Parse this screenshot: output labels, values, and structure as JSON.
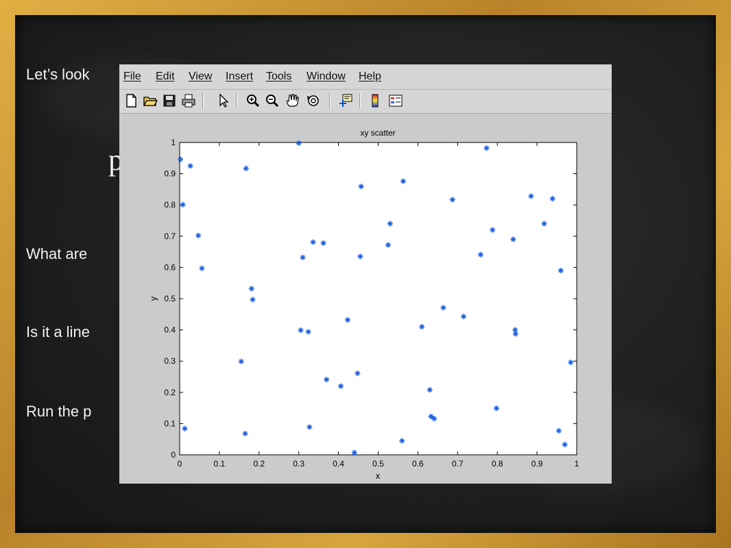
{
  "slide": {
    "line1": "Let’s look",
    "big": "p",
    "line2": "What are",
    "line3": "Is it a line",
    "line4": "Run the p"
  },
  "window": {
    "menu": [
      "File",
      "Edit",
      "View",
      "Insert",
      "Tools",
      "Window",
      "Help"
    ],
    "toolbar_icons": [
      "new-file-icon",
      "open-folder-icon",
      "save-icon",
      "print-icon",
      "pointer-arrow-icon",
      "zoom-in-icon",
      "zoom-out-icon",
      "pan-hand-icon",
      "rotate-3d-icon",
      "data-cursor-icon",
      "colorbar-icon",
      "legend-icon"
    ]
  },
  "chart_data": {
    "type": "scatter",
    "title": "xy scatter",
    "xlabel": "x",
    "ylabel": "y",
    "xlim": [
      0,
      1
    ],
    "ylim": [
      0,
      1
    ],
    "xticks": [
      "0",
      "0.1",
      "0.2",
      "0.3",
      "0.4",
      "0.5",
      "0.6",
      "0.7",
      "0.8",
      "0.9",
      "1"
    ],
    "yticks": [
      "0",
      "0.1",
      "0.2",
      "0.3",
      "0.4",
      "0.5",
      "0.6",
      "0.7",
      "0.8",
      "0.9",
      "1"
    ],
    "marker": "*",
    "marker_color": "#1f5fe0",
    "points": [
      [
        0.002,
        0.946
      ],
      [
        0.027,
        0.925
      ],
      [
        0.008,
        0.801
      ],
      [
        0.047,
        0.702
      ],
      [
        0.056,
        0.597
      ],
      [
        0.013,
        0.084
      ],
      [
        0.167,
        0.917
      ],
      [
        0.181,
        0.532
      ],
      [
        0.184,
        0.497
      ],
      [
        0.155,
        0.299
      ],
      [
        0.165,
        0.068
      ],
      [
        0.3,
        0.998
      ],
      [
        0.31,
        0.632
      ],
      [
        0.336,
        0.681
      ],
      [
        0.362,
        0.678
      ],
      [
        0.305,
        0.399
      ],
      [
        0.324,
        0.394
      ],
      [
        0.327,
        0.089
      ],
      [
        0.37,
        0.241
      ],
      [
        0.457,
        0.859
      ],
      [
        0.455,
        0.635
      ],
      [
        0.423,
        0.432
      ],
      [
        0.406,
        0.22
      ],
      [
        0.448,
        0.261
      ],
      [
        0.44,
        0.007
      ],
      [
        0.563,
        0.876
      ],
      [
        0.53,
        0.74
      ],
      [
        0.525,
        0.672
      ],
      [
        0.61,
        0.41
      ],
      [
        0.56,
        0.045
      ],
      [
        0.63,
        0.208
      ],
      [
        0.633,
        0.123
      ],
      [
        0.641,
        0.116
      ],
      [
        0.687,
        0.817
      ],
      [
        0.664,
        0.471
      ],
      [
        0.715,
        0.443
      ],
      [
        0.773,
        0.982
      ],
      [
        0.758,
        0.641
      ],
      [
        0.788,
        0.72
      ],
      [
        0.798,
        0.149
      ],
      [
        0.84,
        0.69
      ],
      [
        0.845,
        0.4
      ],
      [
        0.846,
        0.387
      ],
      [
        0.885,
        0.828
      ],
      [
        0.918,
        0.74
      ],
      [
        0.939,
        0.82
      ],
      [
        0.96,
        0.59
      ],
      [
        0.985,
        0.296
      ],
      [
        0.955,
        0.077
      ],
      [
        0.97,
        0.033
      ]
    ]
  }
}
